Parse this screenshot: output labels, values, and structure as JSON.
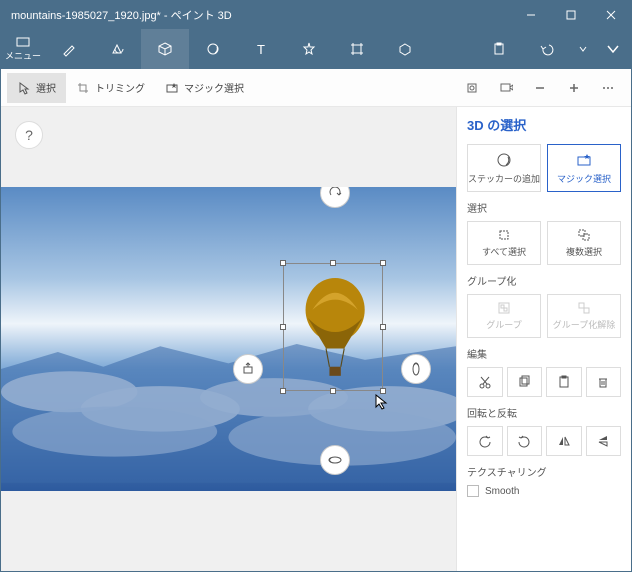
{
  "window": {
    "title": "mountains-1985027_1920.jpg* - ペイント 3D"
  },
  "menu": {
    "label": "メニュー"
  },
  "toolbar": {
    "select": "選択",
    "trim": "トリミング",
    "magic": "マジック選択"
  },
  "sidebar": {
    "title": "3D の選択",
    "sticker": "ステッカーの追加",
    "magic": "マジック選択",
    "sec_select": "選択",
    "select_all": "すべて選択",
    "multi_select": "複数選択",
    "sec_group": "グループ化",
    "group": "グループ",
    "ungroup": "グループ化解除",
    "sec_edit": "編集",
    "sec_rotate": "回転と反転",
    "sec_texture": "テクスチャリング",
    "smooth": "Smooth"
  }
}
